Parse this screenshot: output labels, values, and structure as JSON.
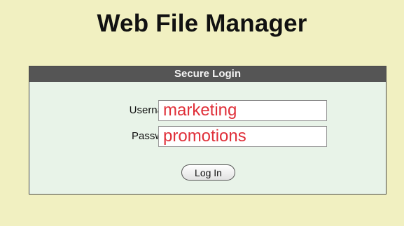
{
  "app": {
    "title": "Web File Manager"
  },
  "login": {
    "header": "Secure Login",
    "username_label": "Username:",
    "username_value": "marketing",
    "password_label": "Password:",
    "password_value": "promotions",
    "submit_label": "Log In"
  },
  "colors": {
    "page_background": "#f1f0c1",
    "panel_header": "#555555",
    "panel_body": "#e8f3e8",
    "input_text": "#e0303a"
  }
}
